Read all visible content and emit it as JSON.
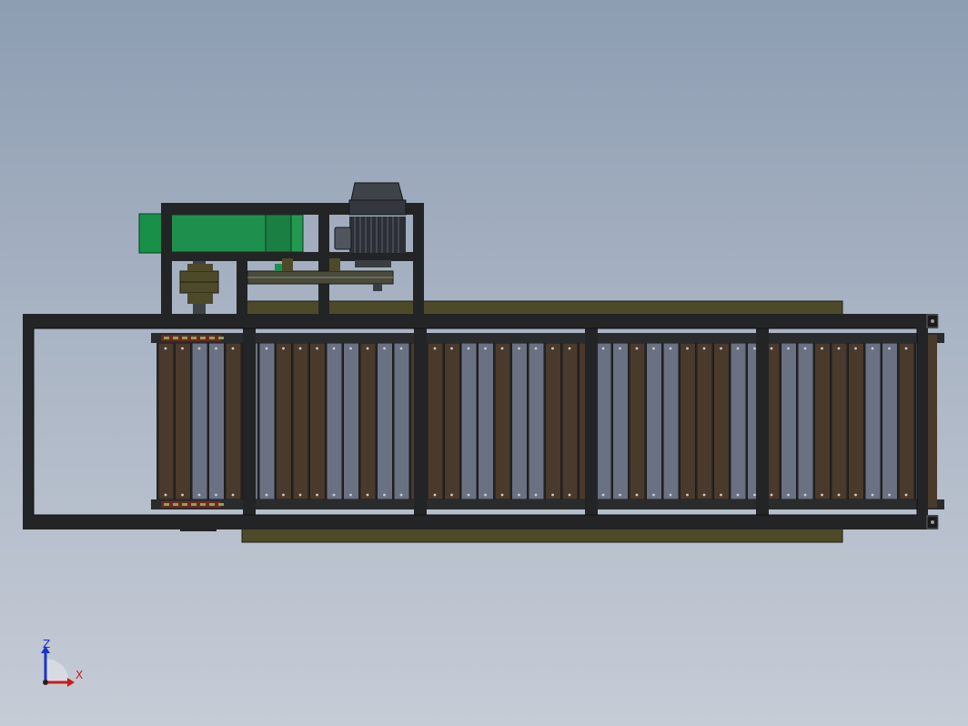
{
  "triad": {
    "z_label": "Z",
    "x_label": "X",
    "z_color": "#1a33cc",
    "x_color": "#cc1a1a"
  },
  "colors": {
    "frame": "#232425",
    "plank_brown": "#4a3a2c",
    "plank_grey": "#6a7183",
    "rail_olive": "#4d4a2a",
    "motor_green": "#1c8a48",
    "motor_dark": "#3a3d42"
  }
}
